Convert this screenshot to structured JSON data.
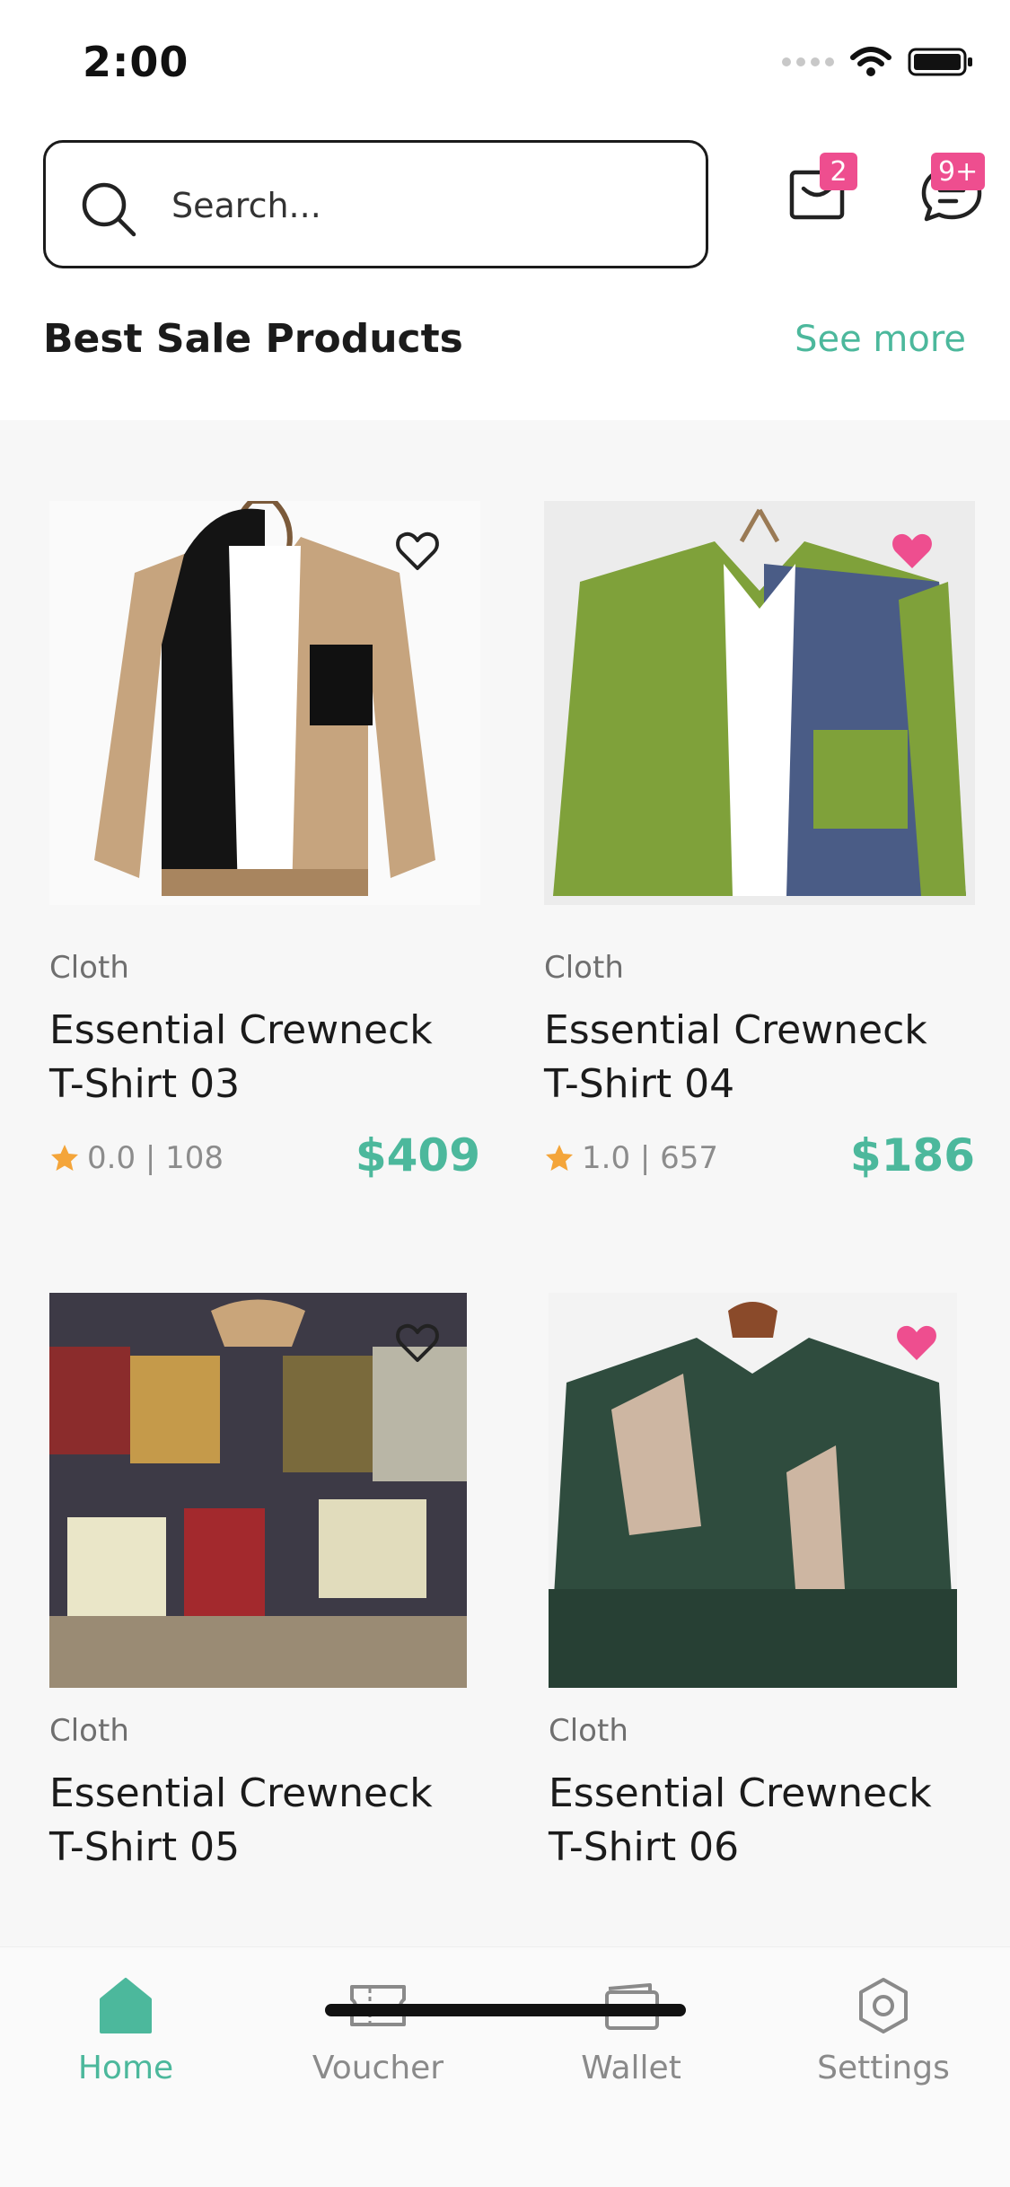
{
  "status_bar": {
    "time": "2:00"
  },
  "header": {
    "search_placeholder": "Search...",
    "cart_badge": "2",
    "chat_badge": "9+"
  },
  "section": {
    "title": "Best Sale Products",
    "see_more": "See more"
  },
  "products": [
    {
      "category": "Cloth",
      "name": "Essential Crewneck T-Shirt 03",
      "rating": "0.0 | 108",
      "price": "$409",
      "favorited": false
    },
    {
      "category": "Cloth",
      "name": "Essential Crewneck T-Shirt 04",
      "rating": "1.0 | 657",
      "price": "$186",
      "favorited": true
    },
    {
      "category": "Cloth",
      "name": "Essential Crewneck T-Shirt 05",
      "favorited": false
    },
    {
      "category": "Cloth",
      "name": "Essential Crewneck T-Shirt 06",
      "favorited": true
    }
  ],
  "nav": {
    "items": [
      {
        "label": "Home",
        "icon": "home-icon",
        "active": true
      },
      {
        "label": "Voucher",
        "icon": "ticket-icon",
        "active": false
      },
      {
        "label": "Wallet",
        "icon": "wallet-icon",
        "active": false
      },
      {
        "label": "Settings",
        "icon": "gear-icon",
        "active": false
      }
    ]
  },
  "colors": {
    "accent": "#4cb89c",
    "badge": "#ee4e8f",
    "star": "#f4a53a"
  }
}
